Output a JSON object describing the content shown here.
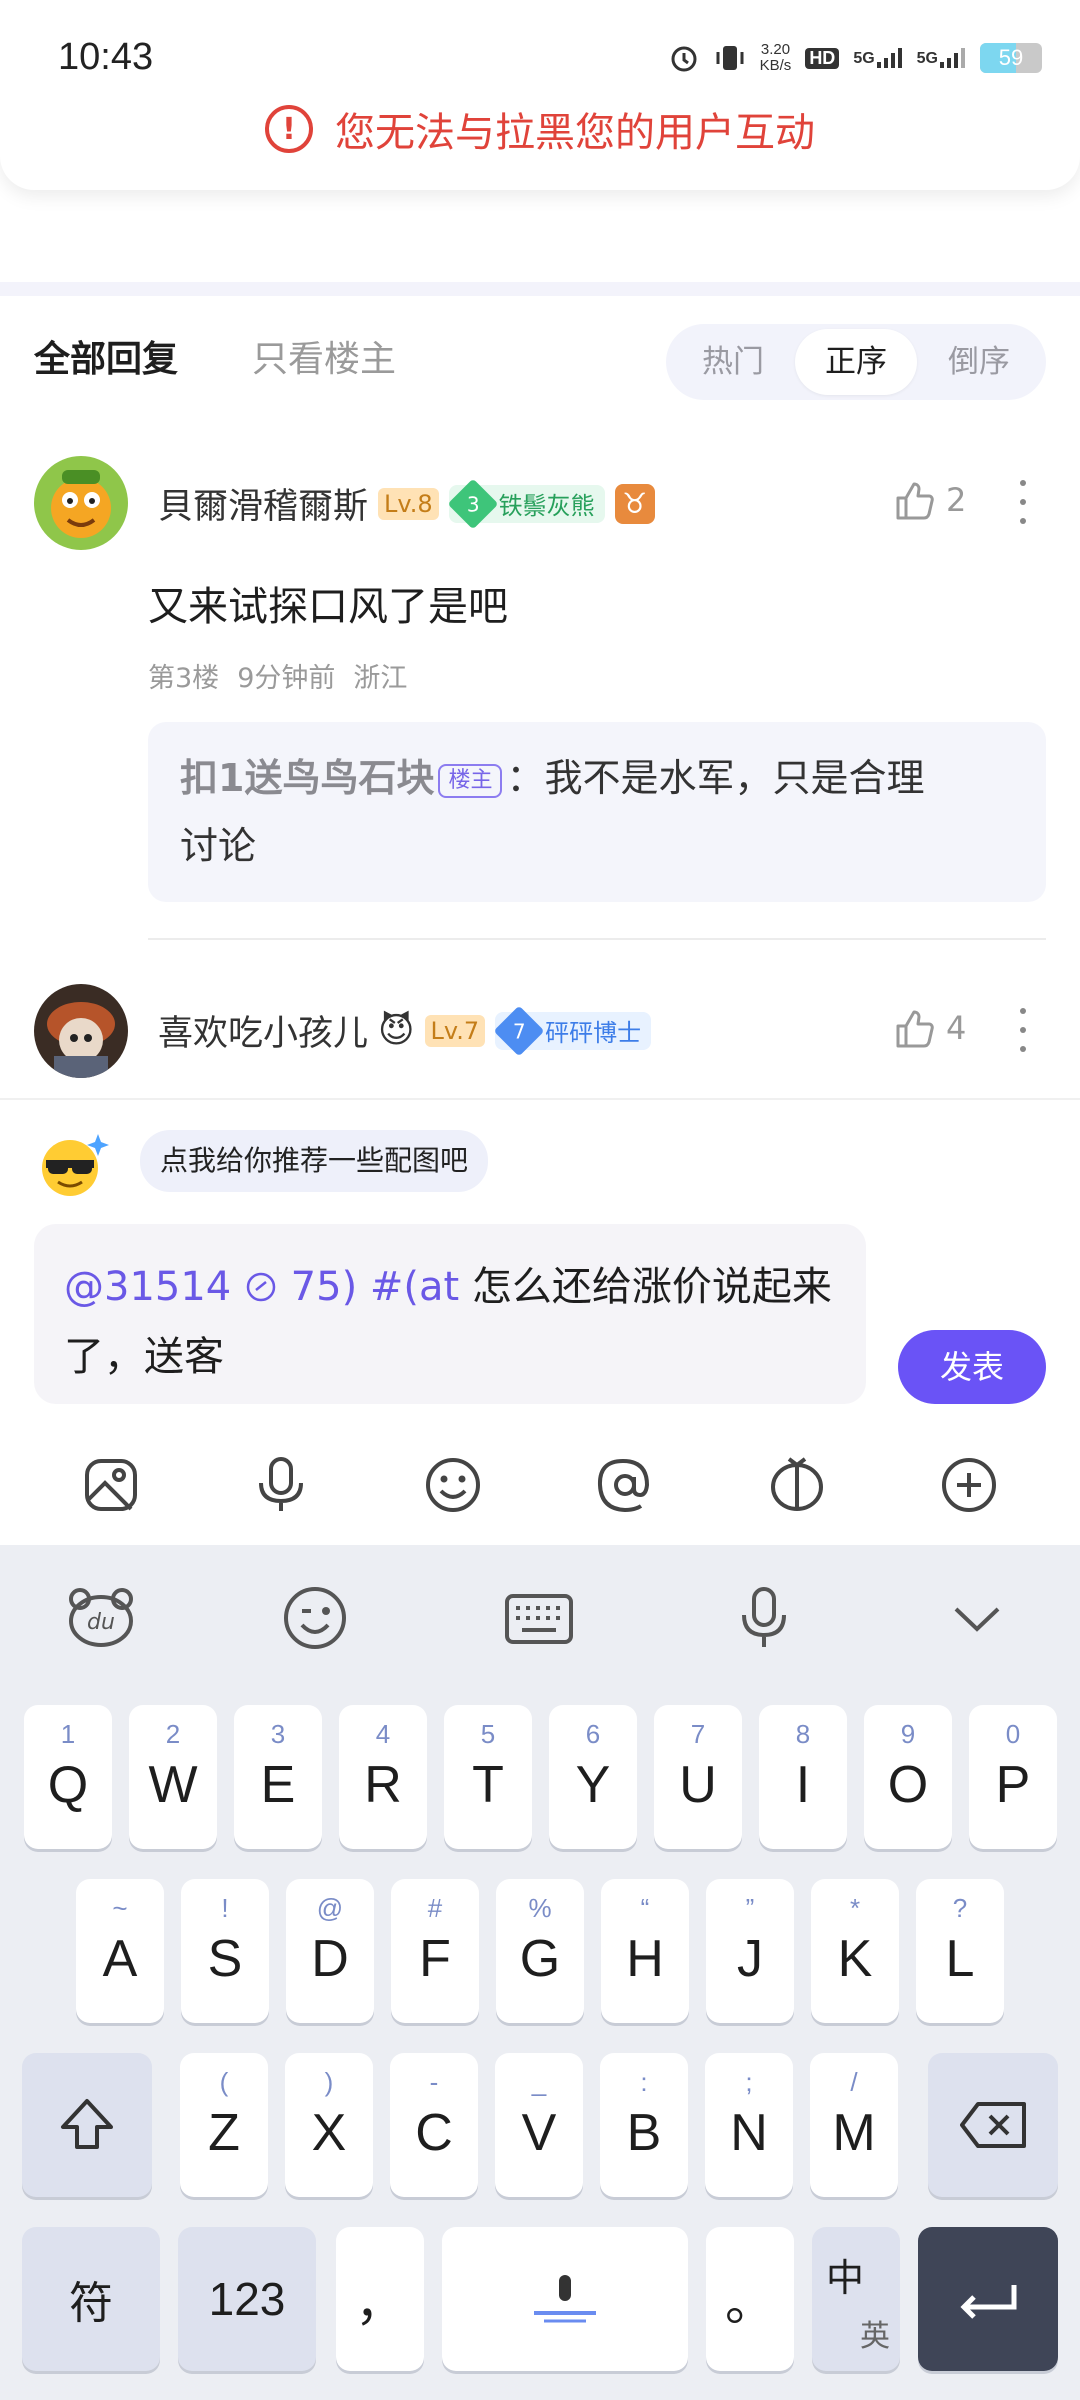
{
  "status": {
    "time": "10:43",
    "speed_top": "3.20",
    "speed_bottom": "KB/s",
    "hd": "HD",
    "net1": "5G",
    "net2": "5G",
    "battery": "59"
  },
  "toast": {
    "message": "您无法与拉黑您的用户互动"
  },
  "tabs": {
    "all_replies": "全部回复",
    "op_only": "只看楼主",
    "sort": [
      "热门",
      "正序",
      "倒序"
    ],
    "sort_selected": "正序"
  },
  "comments": [
    {
      "username": "貝爾滑稽爾斯",
      "level": "Lv.8",
      "medal_num": "3",
      "medal": "铁鬃灰熊",
      "zodiac": "♉",
      "likes": "2",
      "text": "又来试探口风了是吧",
      "floor": "第3楼",
      "time": "9分钟前",
      "location": "浙江",
      "quote": {
        "name": "扣1送鸟鸟石块",
        "tag": "楼主",
        "text_line1": "：我不是水军，只是合理",
        "text_line2": "讨论"
      }
    },
    {
      "username": "喜欢吃小孩儿",
      "emoji": "😈",
      "level": "Lv.7",
      "medal_num": "7",
      "medal": "砰砰博士",
      "likes": "4"
    }
  ],
  "suggest": {
    "text": "点我给你推荐一些配图吧"
  },
  "compose": {
    "mention": "@31514 ",
    "mention2": " 75) #(at",
    "text_line1": " 怎么还给涨价说起来",
    "text_line2": "了，送客"
  },
  "send_label": "发表",
  "keyboard": {
    "row1": [
      [
        "1",
        "Q"
      ],
      [
        "2",
        "W"
      ],
      [
        "3",
        "E"
      ],
      [
        "4",
        "R"
      ],
      [
        "5",
        "T"
      ],
      [
        "6",
        "Y"
      ],
      [
        "7",
        "U"
      ],
      [
        "8",
        "I"
      ],
      [
        "9",
        "O"
      ],
      [
        "0",
        "P"
      ]
    ],
    "row2": [
      [
        "~",
        "A"
      ],
      [
        "!",
        "S"
      ],
      [
        "@",
        "D"
      ],
      [
        "#",
        "F"
      ],
      [
        "%",
        "G"
      ],
      [
        "“",
        "H"
      ],
      [
        "”",
        "J"
      ],
      [
        "*",
        "K"
      ],
      [
        "?",
        "L"
      ]
    ],
    "row3": [
      [
        "(",
        "Z"
      ],
      [
        ")",
        "X"
      ],
      [
        "-",
        "C"
      ],
      [
        "_",
        "V"
      ],
      [
        ":",
        "B"
      ],
      [
        ";",
        "N"
      ],
      [
        "/",
        "M"
      ]
    ],
    "symbols": "符",
    "num": "123",
    "comma": "，",
    "period": "。",
    "lang_top": "中",
    "lang_bottom": "英"
  }
}
